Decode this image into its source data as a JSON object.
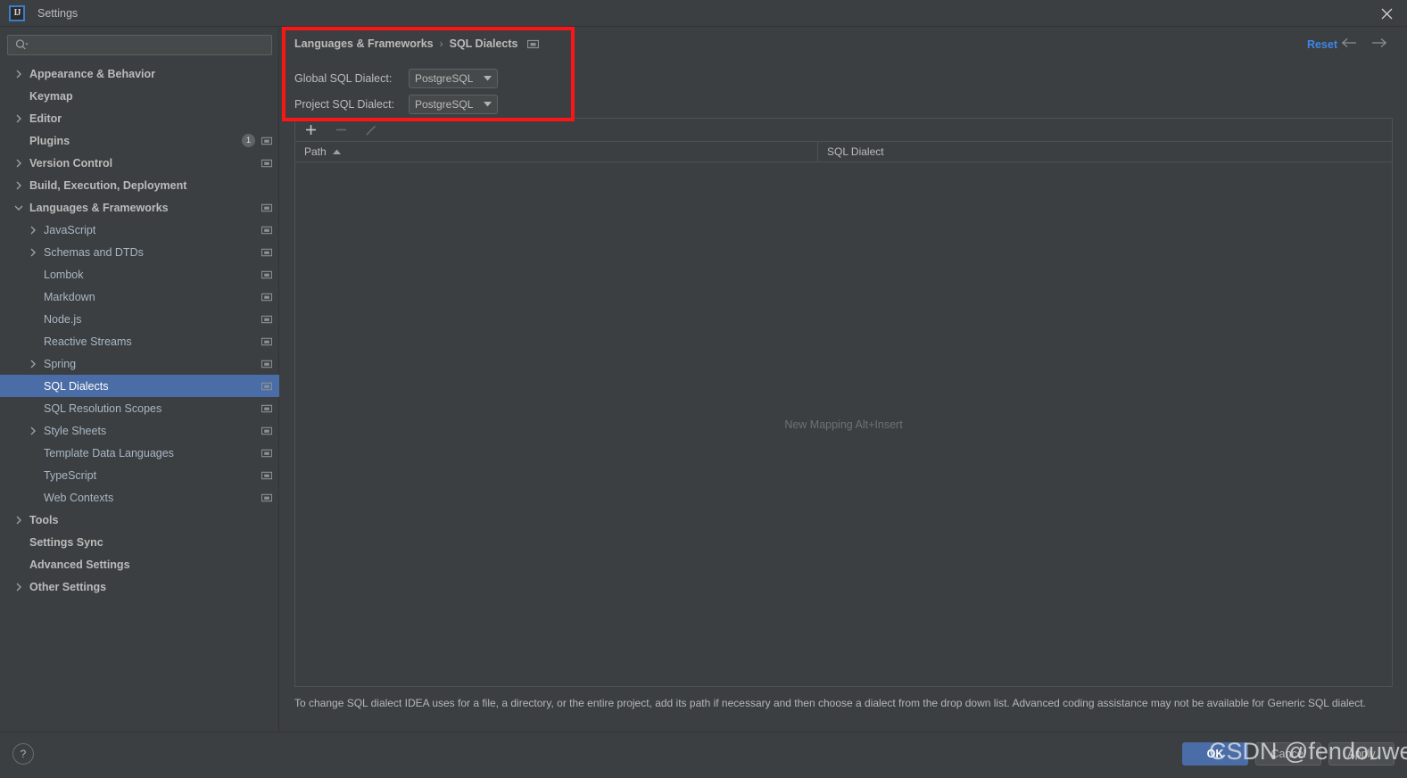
{
  "window": {
    "title": "Settings",
    "logo_text": "IJ",
    "close_label": "×"
  },
  "search": {
    "value": "",
    "placeholder": ""
  },
  "sidebar": {
    "items": [
      {
        "label": "Appearance & Behavior",
        "indent": 0,
        "arrow": "right",
        "bold": true,
        "badge": "",
        "scope": false,
        "selected": false
      },
      {
        "label": "Keymap",
        "indent": 0,
        "arrow": "none",
        "bold": true,
        "badge": "",
        "scope": false,
        "selected": false
      },
      {
        "label": "Editor",
        "indent": 0,
        "arrow": "right",
        "bold": true,
        "badge": "",
        "scope": false,
        "selected": false
      },
      {
        "label": "Plugins",
        "indent": 0,
        "arrow": "none",
        "bold": true,
        "badge": "1",
        "scope": true,
        "selected": false
      },
      {
        "label": "Version Control",
        "indent": 0,
        "arrow": "right",
        "bold": true,
        "badge": "",
        "scope": true,
        "selected": false
      },
      {
        "label": "Build, Execution, Deployment",
        "indent": 0,
        "arrow": "right",
        "bold": true,
        "badge": "",
        "scope": false,
        "selected": false
      },
      {
        "label": "Languages & Frameworks",
        "indent": 0,
        "arrow": "down",
        "bold": true,
        "badge": "",
        "scope": true,
        "selected": false
      },
      {
        "label": "JavaScript",
        "indent": 1,
        "arrow": "right",
        "bold": false,
        "badge": "",
        "scope": true,
        "selected": false
      },
      {
        "label": "Schemas and DTDs",
        "indent": 1,
        "arrow": "right",
        "bold": false,
        "badge": "",
        "scope": true,
        "selected": false
      },
      {
        "label": "Lombok",
        "indent": 1,
        "arrow": "none",
        "bold": false,
        "badge": "",
        "scope": true,
        "selected": false
      },
      {
        "label": "Markdown",
        "indent": 1,
        "arrow": "none",
        "bold": false,
        "badge": "",
        "scope": true,
        "selected": false
      },
      {
        "label": "Node.js",
        "indent": 1,
        "arrow": "none",
        "bold": false,
        "badge": "",
        "scope": true,
        "selected": false
      },
      {
        "label": "Reactive Streams",
        "indent": 1,
        "arrow": "none",
        "bold": false,
        "badge": "",
        "scope": true,
        "selected": false
      },
      {
        "label": "Spring",
        "indent": 1,
        "arrow": "right",
        "bold": false,
        "badge": "",
        "scope": true,
        "selected": false
      },
      {
        "label": "SQL Dialects",
        "indent": 1,
        "arrow": "none",
        "bold": false,
        "badge": "",
        "scope": true,
        "selected": true
      },
      {
        "label": "SQL Resolution Scopes",
        "indent": 1,
        "arrow": "none",
        "bold": false,
        "badge": "",
        "scope": true,
        "selected": false
      },
      {
        "label": "Style Sheets",
        "indent": 1,
        "arrow": "right",
        "bold": false,
        "badge": "",
        "scope": true,
        "selected": false
      },
      {
        "label": "Template Data Languages",
        "indent": 1,
        "arrow": "none",
        "bold": false,
        "badge": "",
        "scope": true,
        "selected": false
      },
      {
        "label": "TypeScript",
        "indent": 1,
        "arrow": "none",
        "bold": false,
        "badge": "",
        "scope": true,
        "selected": false
      },
      {
        "label": "Web Contexts",
        "indent": 1,
        "arrow": "none",
        "bold": false,
        "badge": "",
        "scope": true,
        "selected": false
      },
      {
        "label": "Tools",
        "indent": 0,
        "arrow": "right",
        "bold": true,
        "badge": "",
        "scope": false,
        "selected": false
      },
      {
        "label": "Settings Sync",
        "indent": 0,
        "arrow": "none",
        "bold": true,
        "badge": "",
        "scope": false,
        "selected": false
      },
      {
        "label": "Advanced Settings",
        "indent": 0,
        "arrow": "none",
        "bold": true,
        "badge": "",
        "scope": false,
        "selected": false
      },
      {
        "label": "Other Settings",
        "indent": 0,
        "arrow": "right",
        "bold": true,
        "badge": "",
        "scope": false,
        "selected": false
      }
    ]
  },
  "header": {
    "breadcrumb_parent": "Languages & Frameworks",
    "breadcrumb_sep": "›",
    "breadcrumb_current": "SQL Dialects",
    "reset_label": "Reset"
  },
  "form": {
    "global_label": "Global SQL Dialect:",
    "global_value": "PostgreSQL",
    "project_label": "Project SQL Dialect:",
    "project_value": "PostgreSQL"
  },
  "table": {
    "columns": [
      "Path",
      "SQL Dialect"
    ],
    "sort_column": "Path",
    "sort_direction": "asc",
    "rows": [],
    "empty_text": "New Mapping Alt+Insert"
  },
  "hint": {
    "text": "To change SQL dialect IDEA uses for a file, a directory, or the entire project, add its path if necessary and then choose a dialect from the drop down list. Advanced coding assistance may not be available for Generic SQL dialect."
  },
  "footer": {
    "help_label": "?",
    "ok_label": "OK",
    "cancel_label": "Cancel",
    "apply_label": "Apply"
  },
  "watermark": {
    "text": "CSDN @fendouweiqian"
  },
  "colors": {
    "accent_blue": "#4a6da7",
    "link_blue": "#3d86e8",
    "annotation_red": "#fa1616",
    "panel_bg": "#3c3f41",
    "field_bg": "#45494a"
  }
}
